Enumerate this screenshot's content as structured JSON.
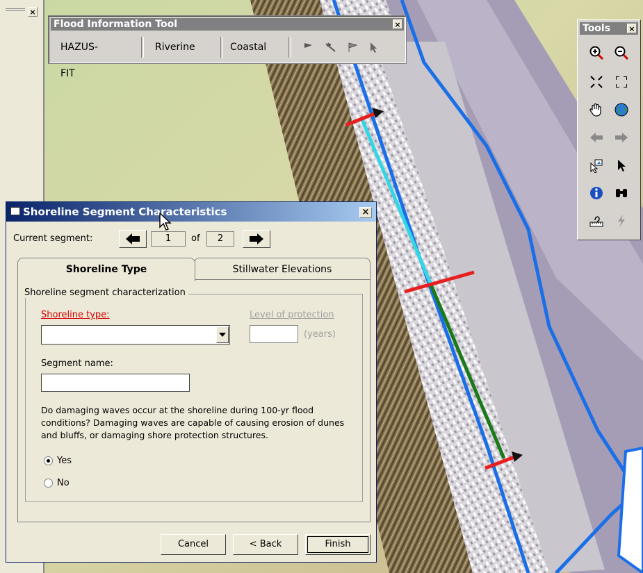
{
  "left_panel": {
    "close_label": "×"
  },
  "fit_toolbar": {
    "title": "Flood Information Tool",
    "close_label": "×",
    "menu": [
      {
        "label": "HAZUS-FIT"
      },
      {
        "label": "Riverine"
      },
      {
        "label": "Coastal"
      }
    ],
    "icons": [
      "flag-icon",
      "tool-wand-icon",
      "flag-outline-icon",
      "select-arrow-icon"
    ]
  },
  "tools_toolbar": {
    "title": "Tools",
    "close_label": "×",
    "icons": [
      "zoom-in-icon",
      "zoom-out-icon",
      "fixed-zoom-in-icon",
      "fixed-zoom-out-icon",
      "pan-hand-icon",
      "full-extent-globe-icon",
      "back-extent-icon",
      "forward-extent-icon",
      "select-features-icon",
      "select-elements-icon",
      "identify-icon",
      "find-binoculars-icon",
      "measure-icon",
      "hyperlink-icon"
    ]
  },
  "dialog": {
    "title": "Shoreline Segment Characteristics",
    "close_label": "×",
    "current_segment_label": "Current segment:",
    "segment_index": "1",
    "of_label": "of",
    "segment_count": "2",
    "tabs": [
      {
        "label": "Shoreline Type",
        "active": true
      },
      {
        "label": "Stillwater Elevations",
        "active": false
      }
    ],
    "group_label": "Shoreline segment characterization",
    "shoreline_type_label": "Shoreline type:",
    "shoreline_type_value": "",
    "level_of_protection_label": "Level of protection",
    "level_of_protection_value": "",
    "years_label": "(years)",
    "segment_name_label": "Segment name:",
    "segment_name_value": "",
    "question_text": "Do damaging waves occur at the shoreline during 100-yr flood conditions?  Damaging waves are capable of causing erosion of dunes and bluffs, or damaging shore protection structures.",
    "radio_yes": "Yes",
    "radio_no": "No",
    "selected_option": "Yes",
    "buttons": {
      "cancel": "Cancel",
      "back": "< Back",
      "finish": "Finish"
    }
  },
  "colors": {
    "river_line": "#1a6fe8",
    "segment_cyan": "#33d6e6",
    "segment_green": "#1a7a1a",
    "transect_red": "#e81f1f",
    "title_bar_active": "#0a246a",
    "title_bar_inactive": "#808080"
  }
}
